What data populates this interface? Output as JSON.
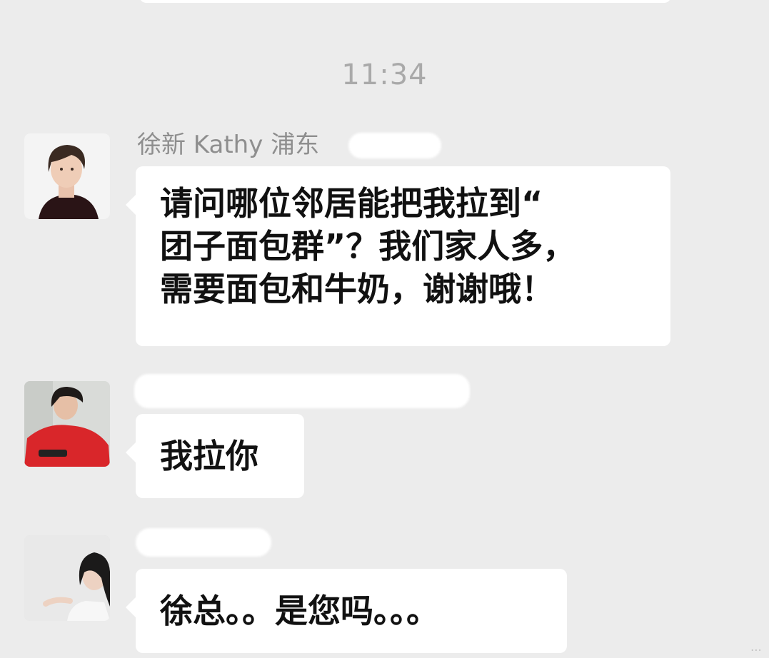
{
  "timestamp": "11:34",
  "messages": [
    {
      "sender": "徐新 Kathy 浦东",
      "text": "请问哪位邻居能把我拉到“\n团子面包群”？我们家人多，\n需要面包和牛奶，谢谢哦！",
      "avatar_icon": "woman-portrait-avatar"
    },
    {
      "sender": "",
      "text": "我拉你",
      "avatar_icon": "woman-red-dress-avatar"
    },
    {
      "sender": "",
      "text": "徐总。。是您吗。。。",
      "avatar_icon": "woman-smiling-avatar"
    }
  ],
  "colors": {
    "background": "#ececec",
    "bubble": "#ffffff",
    "timestamp": "#a9a9a9",
    "sender": "#8e8e8e"
  }
}
